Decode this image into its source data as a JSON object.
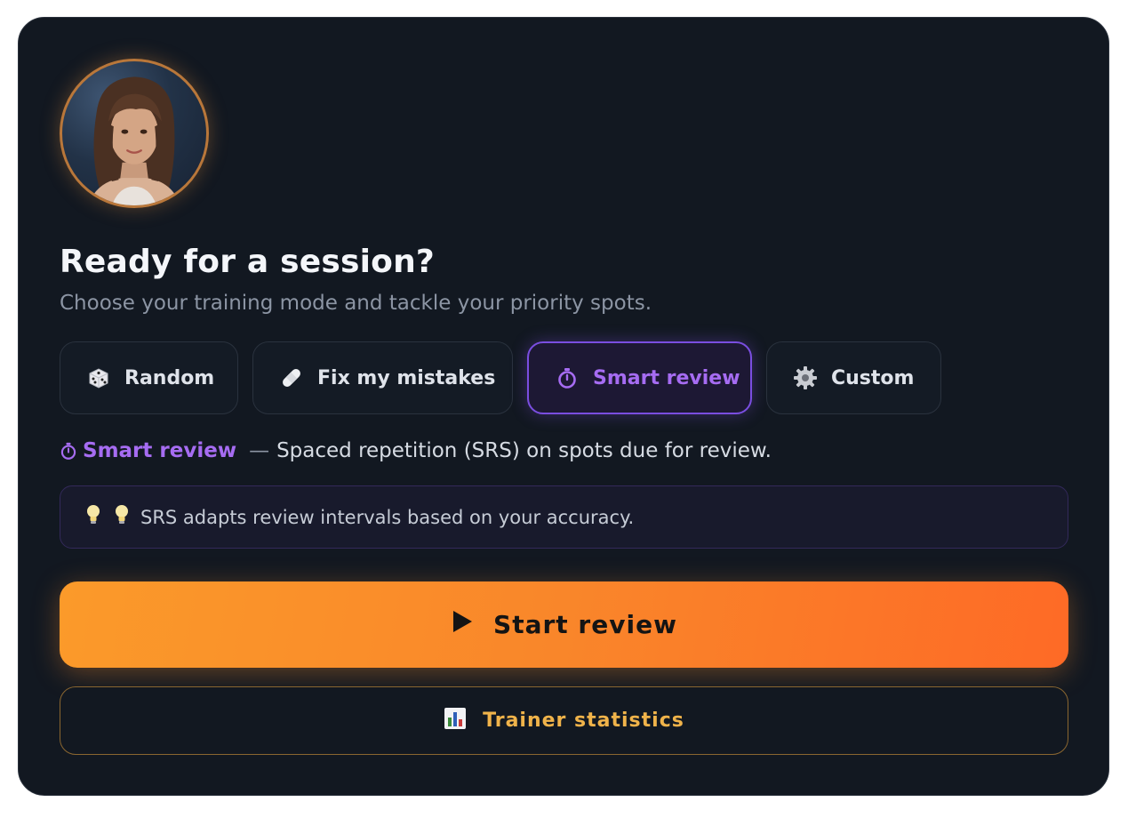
{
  "header": {
    "title": "Ready for a session?",
    "subtitle": "Choose your training mode and tackle your priority spots."
  },
  "modes": [
    {
      "label": "Random",
      "icon": "dice-icon",
      "active": false
    },
    {
      "label": "Fix my mistakes",
      "icon": "bandage-icon",
      "active": false
    },
    {
      "label": "Smart review",
      "icon": "stopwatch-icon",
      "active": true
    },
    {
      "label": "Custom",
      "icon": "gear-icon",
      "active": false
    }
  ],
  "description": {
    "mode_name": "Smart review",
    "dash": "—",
    "text": "Spaced repetition (SRS) on spots due for review."
  },
  "tip": {
    "text": "SRS adapts review intervals based on your accuracy."
  },
  "actions": {
    "start_label": "Start review",
    "stats_label": "Trainer statistics"
  },
  "colors": {
    "accent_purple": "#a66cf2",
    "accent_orange": "#fb8a2a",
    "stats_gold": "#f0b34a",
    "card_bg": "#121821"
  }
}
